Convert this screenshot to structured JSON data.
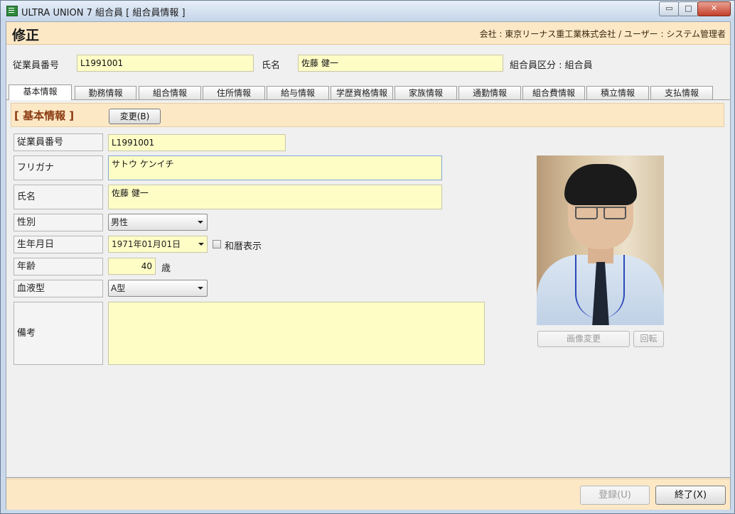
{
  "window": {
    "title": "ULTRA UNION 7 組合員 [ 組合員情報 ]",
    "min_glyph": "▭",
    "max_glyph": "□",
    "close_glyph": "✕"
  },
  "header": {
    "title": "修正",
    "company_info": "会社 : 東京リーナス重工業株式会社 / ユーザー : システム管理者"
  },
  "top": {
    "employee_no_label": "従業員番号",
    "employee_no_value": "L1991001",
    "name_label": "氏名",
    "name_value": "佐藤 健一",
    "member_type": "組合員区分 : 組合員"
  },
  "tabs": [
    {
      "label": "基本情報",
      "active": true
    },
    {
      "label": "勤務情報"
    },
    {
      "label": "組合情報"
    },
    {
      "label": "住所情報"
    },
    {
      "label": "給与情報"
    },
    {
      "label": "学歴資格情報"
    },
    {
      "label": "家族情報"
    },
    {
      "label": "通勤情報"
    },
    {
      "label": "組合費情報"
    },
    {
      "label": "積立情報"
    },
    {
      "label": "支払情報"
    }
  ],
  "section": {
    "title": "[ 基本情報 ]",
    "change_button": "変更(B)"
  },
  "form": {
    "employee_no": {
      "label": "従業員番号",
      "value": "L1991001"
    },
    "furigana": {
      "label": "フリガナ",
      "value": "サトウ ケンイチ"
    },
    "name": {
      "label": "氏名",
      "value": "佐藤 健一"
    },
    "gender": {
      "label": "性別",
      "value": "男性"
    },
    "birthdate": {
      "label": "生年月日",
      "value": "1971年01月01日",
      "wareki_label": "和暦表示",
      "wareki_checked": false
    },
    "age": {
      "label": "年齢",
      "value": "40",
      "unit": "歳"
    },
    "blood_type": {
      "label": "血液型",
      "value": "A型"
    },
    "notes": {
      "label": "備考",
      "value": ""
    }
  },
  "photo": {
    "change_button": "画像変更",
    "rotate_button": "回転"
  },
  "footer": {
    "register_button": "登録(U)",
    "exit_button": "終了(X)"
  }
}
